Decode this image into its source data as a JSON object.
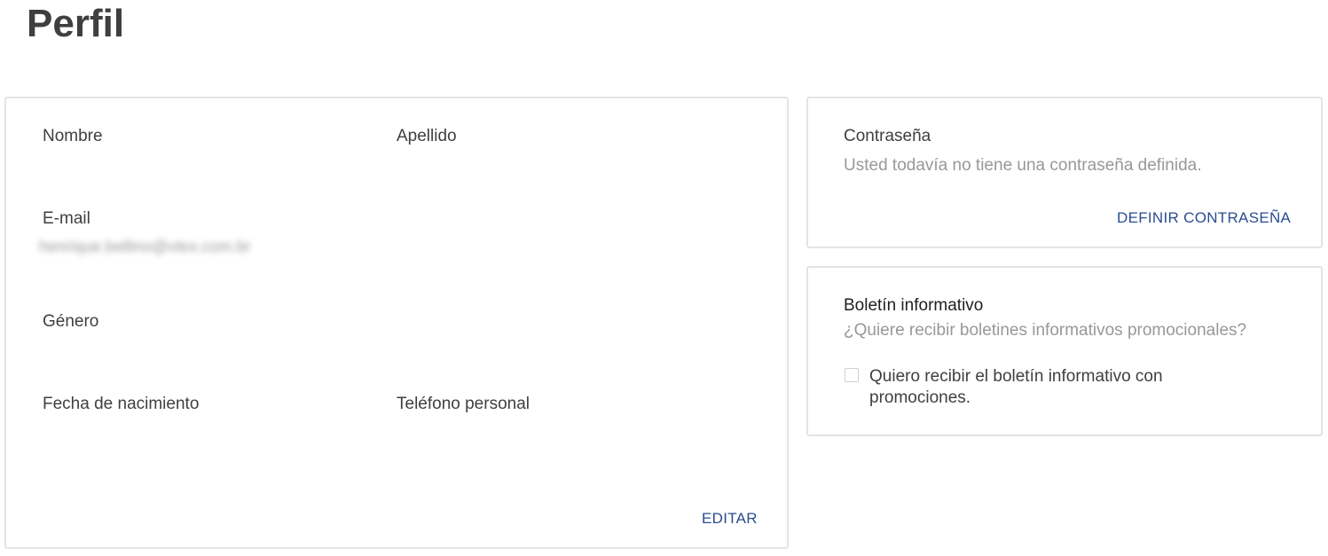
{
  "page": {
    "title": "Perfil"
  },
  "profile": {
    "first_name_label": "Nombre",
    "first_name_value": "",
    "last_name_label": "Apellido",
    "last_name_value": "",
    "email_label": "E-mail",
    "email_value": "henrique.bellino@vtex.com.br",
    "gender_label": "Género",
    "gender_value": "",
    "birthdate_label": "Fecha de nacimiento",
    "birthdate_value": "",
    "phone_label": "Teléfono personal",
    "phone_value": "",
    "edit_label": "EDITAR"
  },
  "password": {
    "heading": "Contraseña",
    "description": "Usted todavía no tiene una contraseña definida.",
    "action_label": "DEFINIR CONTRASEÑA"
  },
  "newsletter": {
    "heading": "Boletín informativo",
    "question": "¿Quiere recibir boletines informativos promocionales?",
    "checkbox_label": "Quiero recibir el boletín informativo con promociones.",
    "checkbox_checked": false
  },
  "colors": {
    "link": "#2a4d8f",
    "text": "#3f3f40",
    "muted": "#979899",
    "border": "#e3e4e6"
  }
}
